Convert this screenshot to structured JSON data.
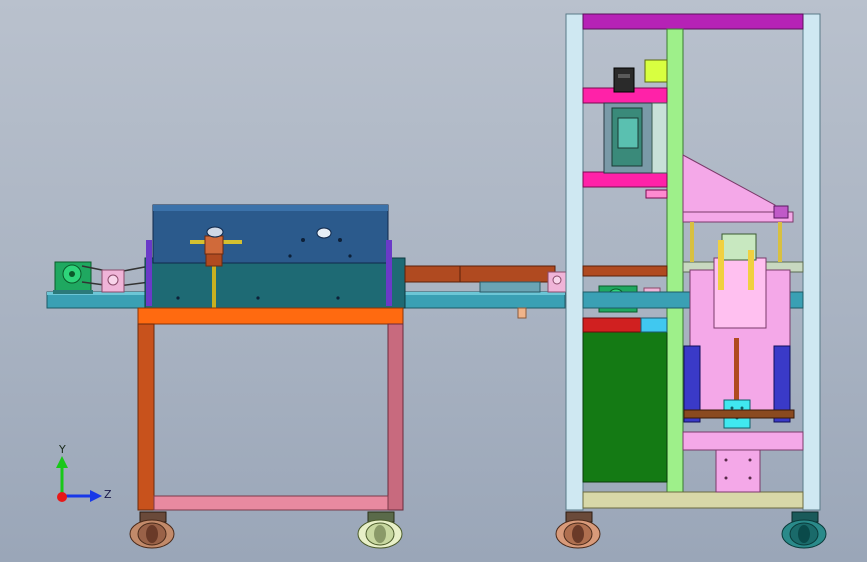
{
  "triad": {
    "y_label": "Y",
    "z_label": "Z"
  },
  "colors": {
    "background": "#aeb7c5",
    "conveyor_base": "#3aa0b4",
    "table_top": "#ff6a10",
    "table_leg_left": "#c8521c",
    "table_leg_right": "#c86a7e",
    "table_rail": "#e88aa0",
    "oven_body": "#2b5a8c",
    "oven_base": "#1e6a74",
    "frame_post": "#cfe8f2",
    "frame_top": "#b622b6",
    "frame_bracket": "#ff22a8",
    "frame_green_post": "#9ef08a",
    "pink_assembly": "#f4a8e8",
    "green_panel": "#147a14",
    "brown_belt": "#b04a20",
    "yellow_motor": "#d8ff40",
    "cyan_block": "#40e8f0"
  }
}
